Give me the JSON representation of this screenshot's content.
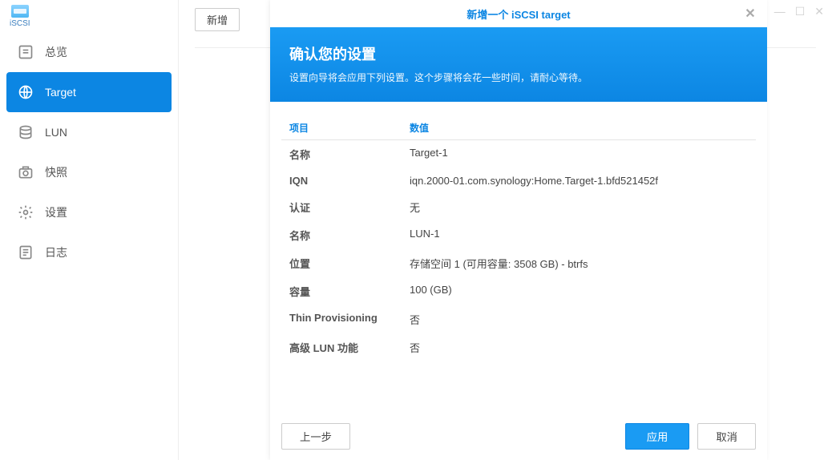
{
  "app": {
    "icon_label": "iSCSI"
  },
  "sidebar": {
    "items": [
      {
        "label": "总览"
      },
      {
        "label": "Target"
      },
      {
        "label": "LUN"
      },
      {
        "label": "快照"
      },
      {
        "label": "设置"
      },
      {
        "label": "日志"
      }
    ],
    "active_index": 1
  },
  "toolbar": {
    "add_label": "新增"
  },
  "modal": {
    "title": "新增一个 iSCSI target",
    "heading": "确认您的设置",
    "subtitle": "设置向导将会应用下列设置。这个步骤将会花一些时间，请耐心等待。",
    "columns": {
      "item": "项目",
      "value": "数值"
    },
    "rows": [
      {
        "key": "名称",
        "value": "Target-1"
      },
      {
        "key": "IQN",
        "value": "iqn.2000-01.com.synology:Home.Target-1.bfd521452f"
      },
      {
        "key": "认证",
        "value": "无"
      },
      {
        "key": "名称",
        "value": "LUN-1"
      },
      {
        "key": "位置",
        "value": "存储空间 1 (可用容量: 3508 GB) - btrfs"
      },
      {
        "key": "容量",
        "value": "100 (GB)"
      },
      {
        "key": "Thin Provisioning",
        "value": "否"
      },
      {
        "key": "高级 LUN 功能",
        "value": "否"
      }
    ],
    "buttons": {
      "back": "上一步",
      "apply": "应用",
      "cancel": "取消"
    }
  }
}
